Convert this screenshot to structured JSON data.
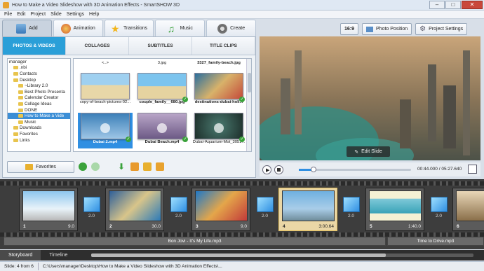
{
  "window": {
    "title": "How to Make a Video Slideshow with 3D Animation Effects - SmartSHOW 3D"
  },
  "menu": [
    "File",
    "Edit",
    "Project",
    "Slide",
    "Settings",
    "Help"
  ],
  "mode_tabs": [
    {
      "label": "Add",
      "icon": "add-photo-icon",
      "active": true
    },
    {
      "label": "Animation",
      "icon": "palette-icon"
    },
    {
      "label": "Transitions",
      "icon": "star-icon"
    },
    {
      "label": "Music",
      "icon": "music-note-icon"
    },
    {
      "label": "Create",
      "icon": "film-reel-icon"
    }
  ],
  "top_right": {
    "aspect": "16:9",
    "photo_position": "Photo Position",
    "project_settings": "Project Settings"
  },
  "sub_tabs": [
    "PHOTOS & VIDEOS",
    "COLLAGES",
    "SUBTITLES",
    "TITLE CLIPS"
  ],
  "tree": [
    "manager",
    ".nbi",
    "Contacts",
    "Desktop",
    "~Library 2.0",
    "Best Photo Presenta",
    "Calendar Creator",
    "Collage Ideas",
    "DONE",
    "How to Make a Vide",
    "Music",
    "Downloads",
    "Favorites",
    "Links"
  ],
  "files": {
    "row0": [
      "<..>",
      "3.jpg",
      "3327_family-beach.jpg"
    ],
    "row1": [
      "copy-of-beach-pictures-02...",
      "couple_family__680.jpg",
      "destinations-dubai-holi..."
    ],
    "row2": [
      "Dubai 2.mp4",
      "Dubai Beach.mp4",
      "Dubai-Aquarium-Mot_3051..."
    ]
  },
  "favorites_label": "Favorites",
  "preview": {
    "edit_slide": "Edit Slide",
    "time": "00:44.000 / 05:27.640",
    "progress": 0.13
  },
  "slides": [
    {
      "num": "1",
      "dur": "9.0"
    },
    {
      "num": "2",
      "dur": "30.0"
    },
    {
      "num": "3",
      "dur": "9.0"
    },
    {
      "num": "4",
      "dur": "3:00.64"
    },
    {
      "num": "5",
      "dur": "1:40.0"
    },
    {
      "num": "6",
      "dur": ""
    }
  ],
  "transitions": [
    "2.0",
    "2.0",
    "2.0",
    "2.0",
    "2.0"
  ],
  "audio": [
    "Bon Jovi - It's My Life.mp3",
    "Time to Drive.mp3"
  ],
  "bottom_tabs": [
    "Storyboard",
    "Timeline"
  ],
  "status": {
    "slide": "Slide: 4 from 6",
    "path": "C:\\Users\\manager\\Desktop\\How to Make a Video Slideshow with 3D Animation Effects\\..."
  },
  "colors": {
    "accent": "#2a9fd8",
    "selected_slide": "#e6c25e"
  }
}
